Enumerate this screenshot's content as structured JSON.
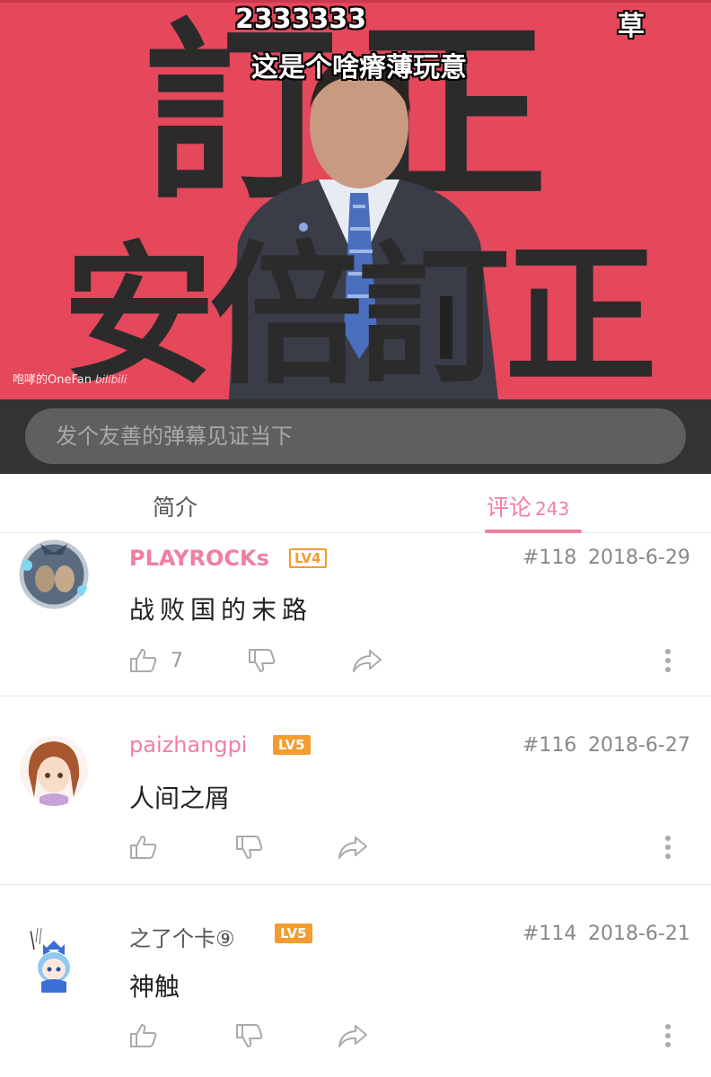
{
  "video": {
    "bg_color": "#e5475b",
    "overlay_top_left": "訂",
    "overlay_top_right": "正",
    "overlay_bottom": "安倍訂正",
    "danmaku": [
      "2333333",
      "草",
      "这是个啥瘠薄玩意"
    ],
    "watermark": "咆哮的OneFan",
    "watermark_logo": "bilibili"
  },
  "danmaku_input": {
    "placeholder": "发个友善的弹幕见证当下"
  },
  "tabs": [
    {
      "label": "简介",
      "active": false
    },
    {
      "label": "评论",
      "count": "243",
      "active": true
    }
  ],
  "accent_color": "#f07fa0",
  "comments": [
    {
      "username": "PLAYROCKs",
      "level": "LV4",
      "floor": "#118",
      "date": "2018-6-29",
      "text": "战败国的末路",
      "likes": "7"
    },
    {
      "username": "paizhangpi",
      "level": "LV5",
      "floor": "#116",
      "date": "2018-6-27",
      "text": "人间之屑",
      "likes": ""
    },
    {
      "username": "之了个卡⑨",
      "level": "LV5",
      "floor": "#114",
      "date": "2018-6-21",
      "text": "神触",
      "likes": ""
    }
  ],
  "icons": [
    "thumb-up-icon",
    "thumb-down-icon",
    "share-icon",
    "more-vertical-icon"
  ]
}
